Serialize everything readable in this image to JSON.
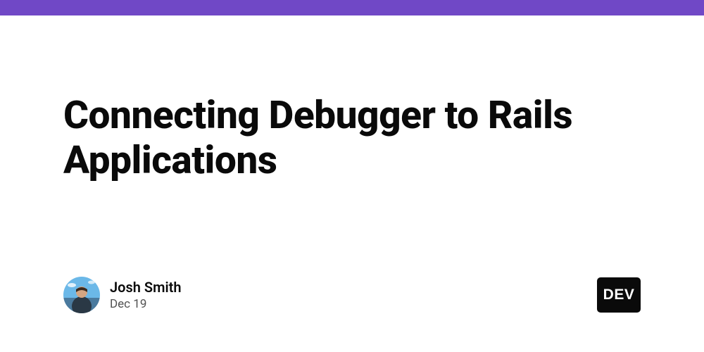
{
  "accent_color": "#7048c6",
  "title": "Connecting Debugger to Rails Applications",
  "author": {
    "name": "Josh Smith",
    "date": "Dec 19"
  },
  "badge": {
    "text": "DEV"
  }
}
